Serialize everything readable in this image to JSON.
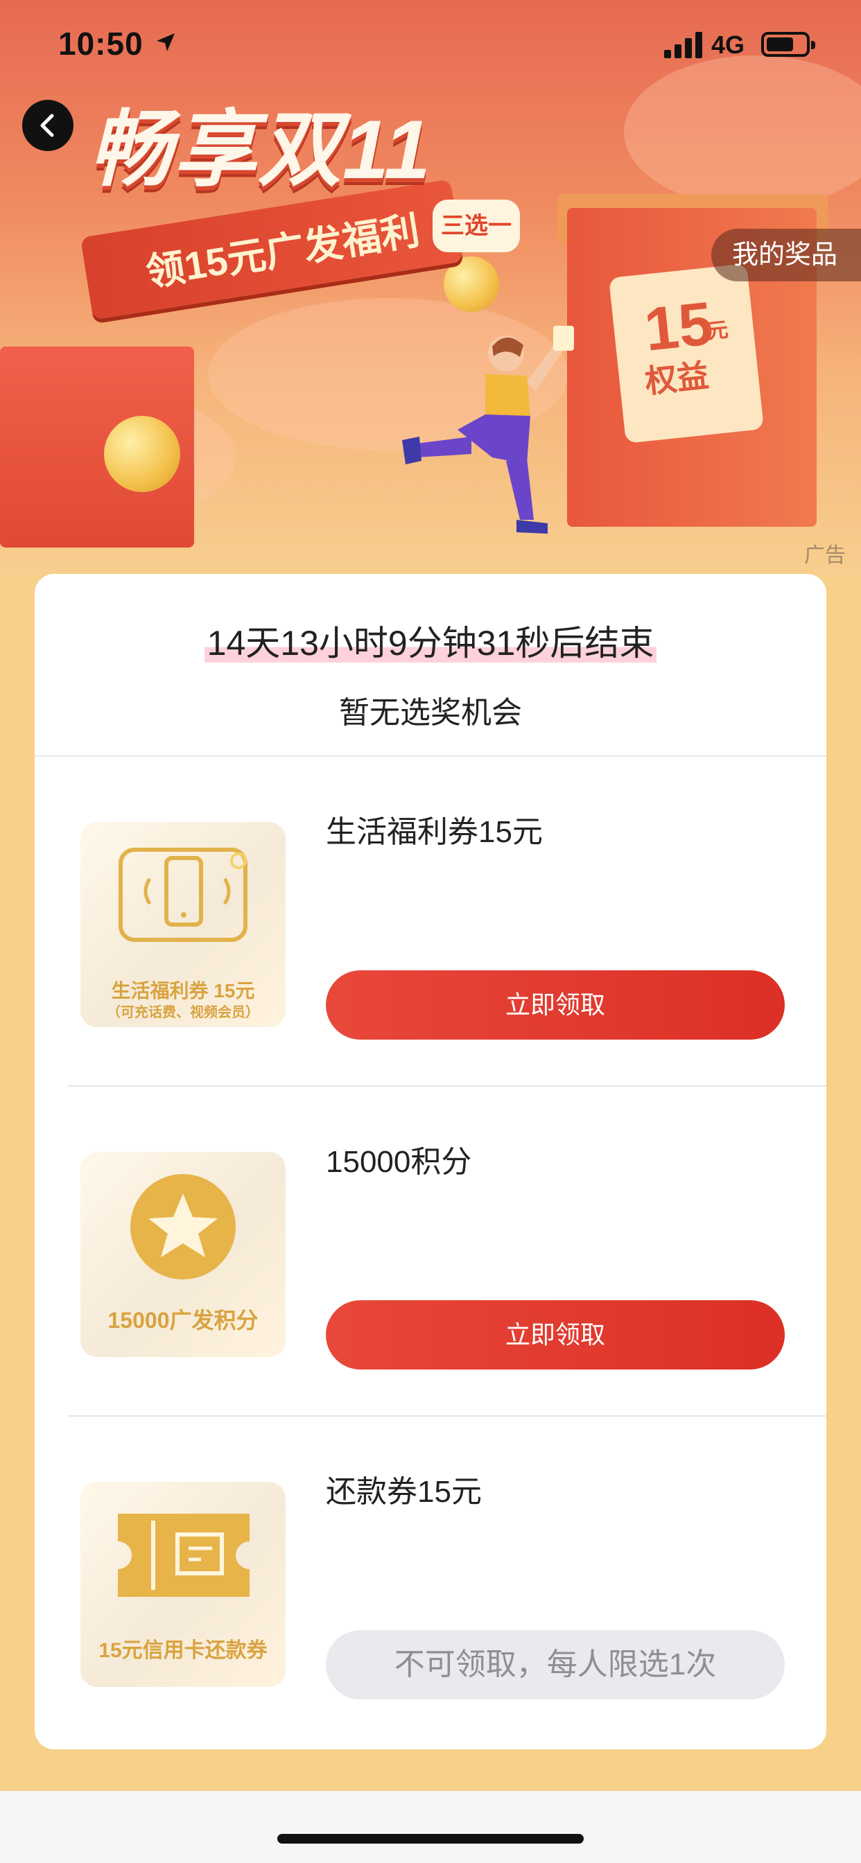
{
  "status_bar": {
    "time": "10:50",
    "network": "4G"
  },
  "banner": {
    "title": "畅享双11",
    "ribbon_text": "领15元广发福利",
    "tag": "三选一",
    "my_prizes_label": "我的奖品",
    "gift_number": "15",
    "gift_unit": "元",
    "gift_word": "权益",
    "ad_label": "广告"
  },
  "campaign": {
    "countdown": "14天13小时9分钟31秒后结束",
    "no_chance_text": "暂无选奖机会"
  },
  "rewards": [
    {
      "title": "生活福利券15元",
      "thumb_line1": "生活福利券 15元",
      "thumb_line2": "（可充话费、视频会员）",
      "button": "立即领取",
      "state": "active"
    },
    {
      "title": "15000积分",
      "thumb_line1": "15000广发积分",
      "thumb_line2": "",
      "button": "立即领取",
      "state": "active"
    },
    {
      "title": "还款券15元",
      "thumb_line1": "15元信用卡还款券",
      "thumb_line2": "",
      "button": "不可领取，每人限选1次",
      "state": "disabled"
    }
  ],
  "colors": {
    "accent_red": "#e0392c",
    "page_bg": "#f7d08a",
    "gold": "#d9a340"
  }
}
